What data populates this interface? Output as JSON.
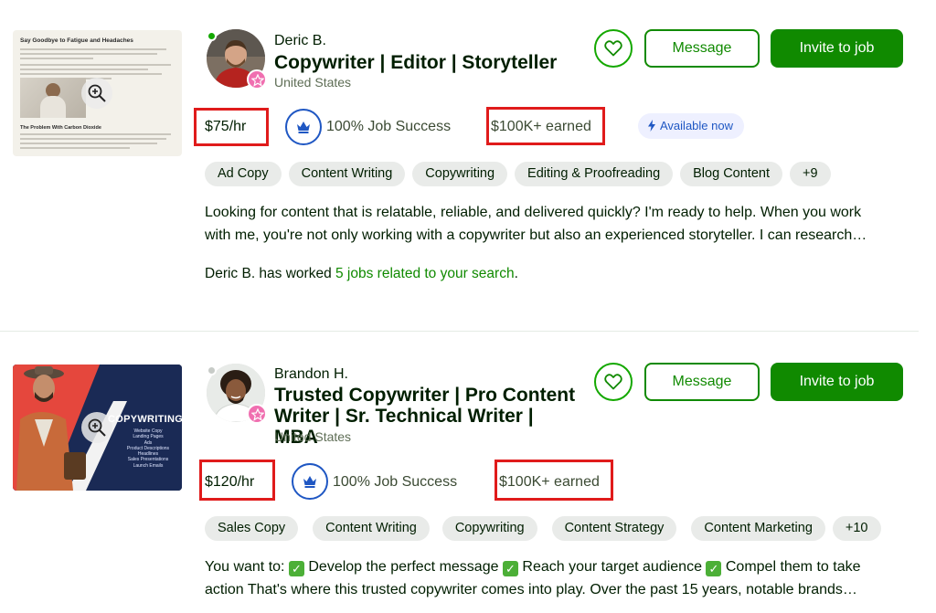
{
  "colors": {
    "accent": "#108a00",
    "highlight": "#e01b1b",
    "badge": "#1f57c3",
    "top_rated_badge": "#f06fb0"
  },
  "freelancers": [
    {
      "name": "Deric B.",
      "online": true,
      "title": "Copywriter | Editor | Storyteller",
      "location": "United States",
      "rate": "$75/hr",
      "job_success": "100% Job Success",
      "earned": "$100K+ earned",
      "availability": "Available now",
      "skills": [
        "Ad Copy",
        "Content Writing",
        "Copywriting",
        "Editing & Proofreading",
        "Blog Content",
        "+9"
      ],
      "description_lines": [
        "Looking for content that is relatable, reliable, and delivered quickly? I'm ready to help. When you work",
        "with me, you're not only working with a copywriter but also an experienced storyteller. I can research…"
      ],
      "worked_prefix": "Deric B. has worked ",
      "worked_link": "5 jobs related to your search",
      "worked_suffix": ".",
      "portfolio": {
        "heading": "Say Goodbye to Fatigue and Headaches",
        "subheading": "The Problem With Carbon Dioxide"
      },
      "message_label": "Message",
      "invite_label": "Invite to job"
    },
    {
      "name": "Brandon H.",
      "online": false,
      "title_lines": [
        "Trusted Copywriter | Pro Content",
        "Writer | Sr. Technical Writer | MBA"
      ],
      "location": "United States",
      "rate": "$120/hr",
      "job_success": "100% Job Success",
      "earned": "$100K+ earned",
      "skills": [
        "Sales Copy",
        "Content Writing",
        "Copywriting",
        "Content Strategy",
        "Content Marketing",
        "+10"
      ],
      "description_lines": [
        [
          "You want to: ",
          "Develop the perfect message ",
          "Reach your target audience ",
          "Compel them to take"
        ],
        "action That's where this trusted copywriter comes into play. Over the past 15 years, notable brands…"
      ],
      "portfolio": {
        "heading": "COPYWRITING",
        "items": [
          "Website Copy",
          "Landing Pages",
          "Ads",
          "Product Descriptions",
          "Headlines",
          "Sales Presentations",
          "Launch Emails"
        ]
      },
      "message_label": "Message",
      "invite_label": "Invite to job"
    }
  ]
}
